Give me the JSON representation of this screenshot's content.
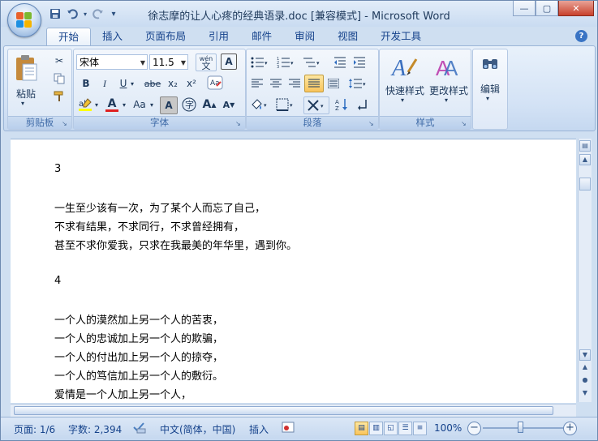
{
  "window": {
    "title": "徐志摩的让人心疼的经典语录.doc [兼容模式] - Microsoft Word"
  },
  "quick_access": {
    "save": "save-icon",
    "undo": "undo-icon",
    "redo": "redo-icon",
    "customize": "▾"
  },
  "window_buttons": {
    "minimize": "—",
    "maximize": "▢",
    "close": "✕"
  },
  "tabs": [
    {
      "label": "开始",
      "active": true
    },
    {
      "label": "插入"
    },
    {
      "label": "页面布局"
    },
    {
      "label": "引用"
    },
    {
      "label": "邮件"
    },
    {
      "label": "审阅"
    },
    {
      "label": "视图"
    },
    {
      "label": "开发工具"
    }
  ],
  "help": "?",
  "ribbon": {
    "clipboard": {
      "paste_label": "粘贴",
      "group_label": "剪贴板"
    },
    "font": {
      "font_name": "宋体",
      "font_size": "11.5",
      "group_label": "字体",
      "phonetic": "wén",
      "bold": "B",
      "italic": "I",
      "underline": "U",
      "strike": "abe",
      "subscript": "x₂",
      "superscript": "x²",
      "grow": "A",
      "shrink": "A",
      "case": "Aa",
      "char_border": "A"
    },
    "paragraph": {
      "group_label": "段落"
    },
    "styles": {
      "quick_styles": "快速样式",
      "change_styles": "更改样式",
      "group_label": "样式"
    },
    "editing": {
      "label": "编辑"
    }
  },
  "document": {
    "lines": [
      "3",
      "一生至少该有一次，为了某个人而忘了自己，",
      "不求有结果，不求同行，不求曾经拥有，",
      "甚至不求你爱我，只求在我最美的年华里，遇到你。",
      "4",
      "一个人的漠然加上另一个人的苦衷，",
      "一个人的忠诚加上另一个人的欺骗，",
      "一个人的付出加上另一个人的掠夺，",
      "一个人的笃信加上另一个人的敷衍。",
      "爱情是一个人加上另一个人，"
    ]
  },
  "status": {
    "page": "页面: 1/6",
    "words": "字数: 2,394",
    "language": "中文(简体，中国)",
    "insert": "插入",
    "zoom": "100%",
    "zoom_value": 1.0
  }
}
